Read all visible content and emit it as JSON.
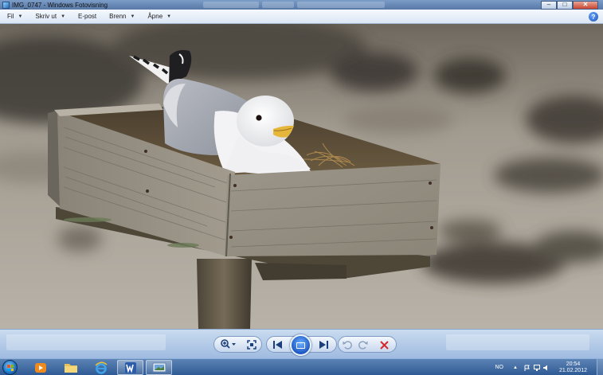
{
  "window": {
    "title": "IMG_0747 - Windows Fotovisning",
    "caption_buttons": {
      "minimize": "–",
      "maximize": "□",
      "close": "✕"
    }
  },
  "menu": {
    "items": [
      {
        "label": "Fil"
      },
      {
        "label": "Skriv ut"
      },
      {
        "label": "E-post"
      },
      {
        "label": "Brenn"
      },
      {
        "label": "Åpne"
      }
    ],
    "help": "?"
  },
  "controls": {
    "zoom": "zoom-icon",
    "fit": "fit-to-window-icon",
    "previous": "previous-icon",
    "slideshow": "slideshow-icon",
    "next": "next-icon",
    "rotate_ccw": "rotate-counterclockwise-icon",
    "rotate_cw": "rotate-clockwise-icon",
    "delete": "delete-icon"
  },
  "taskbar": {
    "language": "NO",
    "time": "20:54",
    "date": "21.02.2012",
    "pinned": [
      "media-player",
      "explorer",
      "internet-explorer",
      "word",
      "photo-viewer"
    ]
  },
  "colors": {
    "accent": "#1d58c4",
    "delete": "#d42a2a"
  }
}
